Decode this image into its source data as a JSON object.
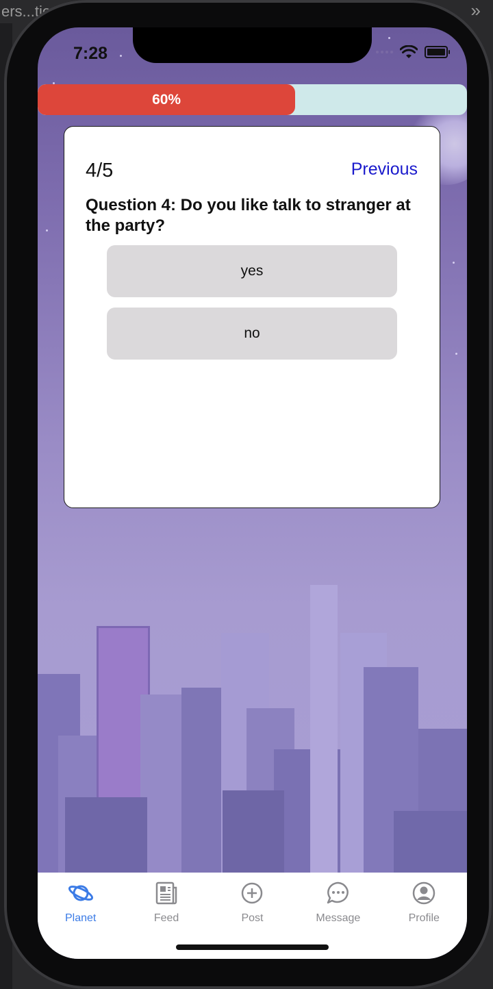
{
  "desktop": {
    "tab_text": "ers...tio",
    "chevron": "»"
  },
  "status_bar": {
    "time": "7:28"
  },
  "progress": {
    "percent": 60,
    "label": "60%",
    "fill_color": "#dd463a",
    "track_color": "#cfe9ea"
  },
  "quiz": {
    "counter": "4/5",
    "previous_label": "Previous",
    "question": "Question 4: Do you like talk to stranger at the party?",
    "answers": [
      {
        "label": "yes"
      },
      {
        "label": "no"
      }
    ]
  },
  "tab_bar": {
    "active_color": "#3b7be6",
    "items": [
      {
        "label": "Planet",
        "icon": "planet-icon",
        "active": true
      },
      {
        "label": "Feed",
        "icon": "feed-icon",
        "active": false
      },
      {
        "label": "Post",
        "icon": "plus-circle-icon",
        "active": false
      },
      {
        "label": "Message",
        "icon": "chat-bubble-icon",
        "active": false
      },
      {
        "label": "Profile",
        "icon": "user-circle-icon",
        "active": false
      }
    ]
  }
}
